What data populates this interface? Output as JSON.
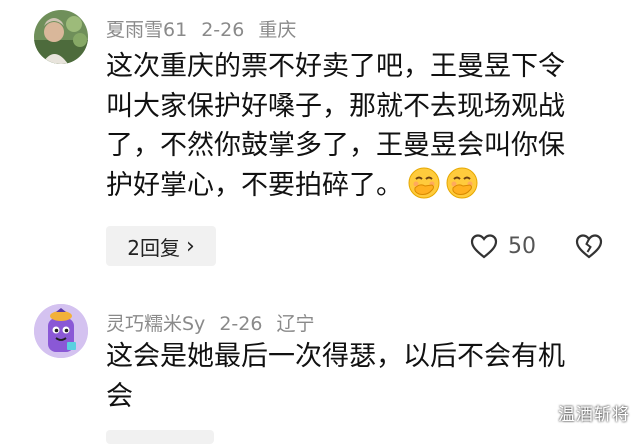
{
  "comments": [
    {
      "username": "夏雨雪61",
      "date": "2-26",
      "location": "重庆",
      "lines": [
        "这次重庆的票不好卖了吧，王曼昱下令",
        "叫大家保护好嗓子，那就不去现场观战",
        "了，不然你鼓掌多了，王曼昱会叫你保",
        "护好掌心，不要拍碎了。"
      ],
      "emoji_icons": [
        "hand-over-mouth-emoji",
        "hand-over-mouth-emoji"
      ],
      "reply_label": "2回复",
      "likes": "50"
    },
    {
      "username": "灵巧糯米Sy",
      "date": "2-26",
      "location": "辽宁",
      "lines": [
        "这会是她最后一次得瑟，以后不会有机",
        "会"
      ]
    }
  ],
  "watermark": "温酒斩将",
  "colors": {
    "meta": "#8a8a8a",
    "pill": "#f1f1f1",
    "text": "#111111"
  }
}
